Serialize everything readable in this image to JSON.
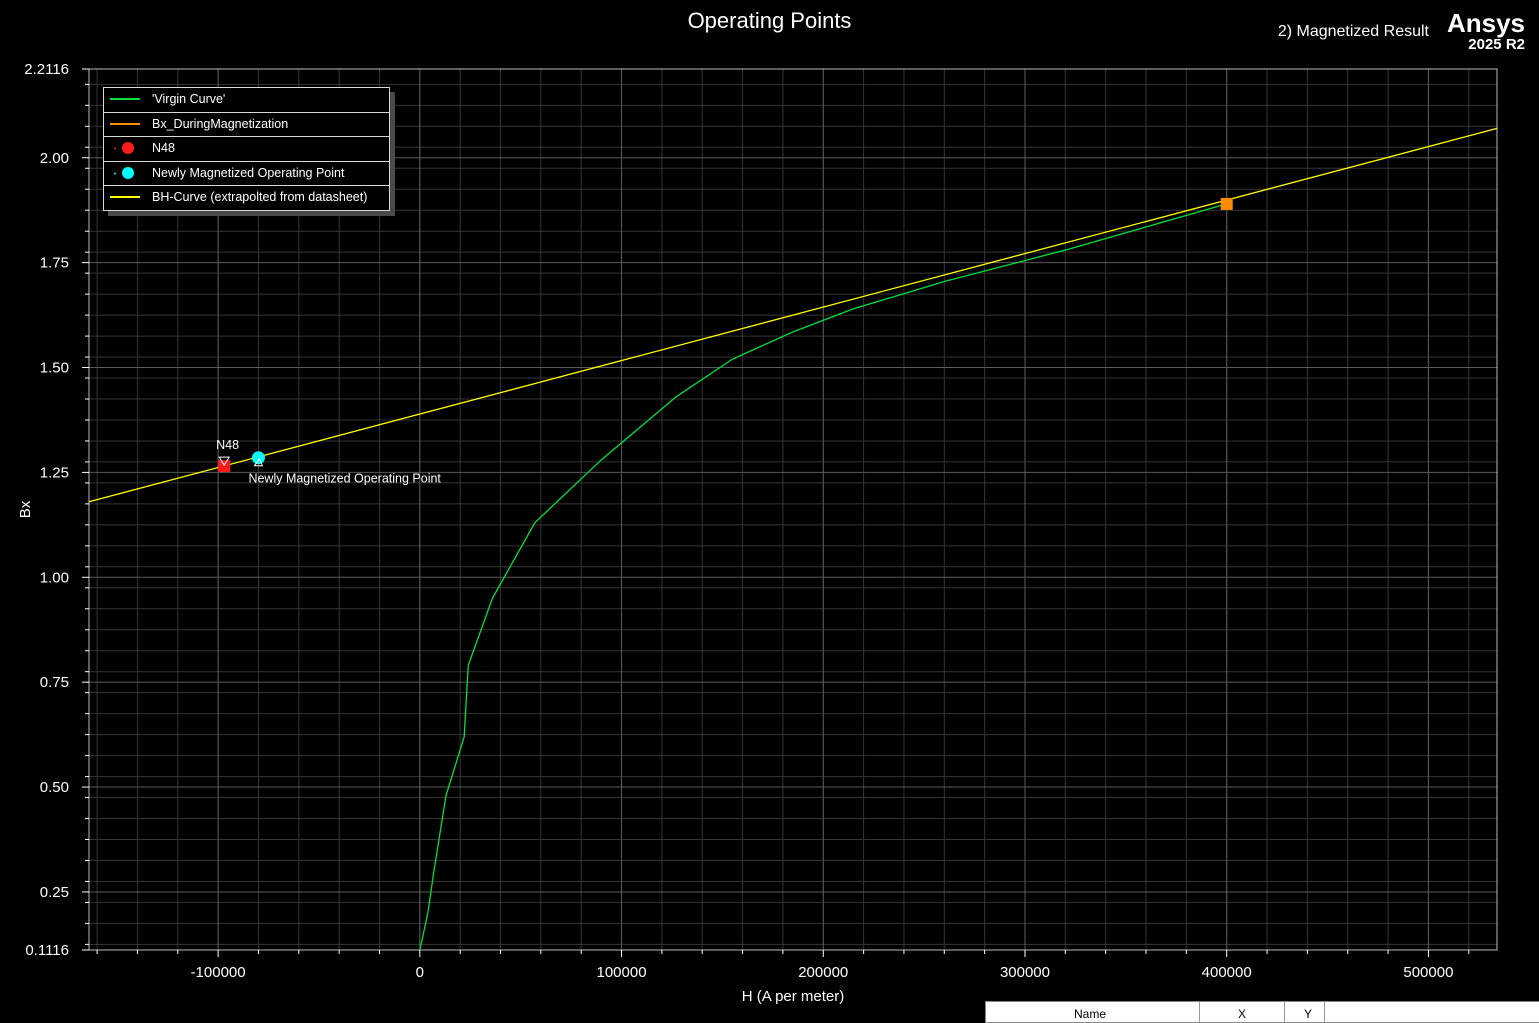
{
  "header": {
    "title": "Operating Points",
    "design_name": "2) Magnetized Result",
    "brand": "Ansys",
    "version": "2025 R2"
  },
  "colors": {
    "background": "#000000",
    "grid": "#5a5a5a",
    "axis_text": "#ffffff",
    "virgin": "#00e040",
    "during": "#ff8c00",
    "n48": "#ff1a1a",
    "newly": "#00ffff",
    "bh": "#ffff00"
  },
  "legend": [
    {
      "label": "'Virgin Curve'",
      "kind": "line",
      "color": "#00e040"
    },
    {
      "label": "Bx_DuringMagnetization",
      "kind": "line",
      "color": "#ff8c00"
    },
    {
      "label": "N48",
      "kind": "marker",
      "color": "#ff1a1a"
    },
    {
      "label": "Newly Magnetized Operating Point",
      "kind": "marker",
      "color": "#00ffff"
    },
    {
      "label": "BH-Curve (extrapolted from datasheet)",
      "kind": "line",
      "color": "#ffff00"
    }
  ],
  "chart_data": {
    "type": "line",
    "title": "Operating Points",
    "xlabel": "H (A  per  meter)",
    "ylabel": "Bx",
    "xlim": [
      -164000,
      534000
    ],
    "ylim": [
      0.1116,
      2.2116
    ],
    "x_ticks": [
      -100000,
      0,
      100000,
      200000,
      300000,
      400000,
      500000
    ],
    "x_tick_labels": [
      "-100000",
      "0",
      "100000",
      "200000",
      "300000",
      "400000",
      "500000"
    ],
    "x_minor_step": 20000,
    "y_ticks": [
      0.1116,
      0.25,
      0.5,
      0.75,
      1.0,
      1.25,
      1.5,
      1.75,
      2.0,
      2.2116
    ],
    "y_tick_labels": [
      "0.1116",
      "0.25",
      "0.50",
      "0.75",
      "1.00",
      "1.25",
      "1.50",
      "1.75",
      "2.00",
      "2.2116"
    ],
    "grid": true,
    "legend_position": "top-left",
    "series": [
      {
        "name": "'Virgin Curve'",
        "color": "#00e040",
        "points": [
          [
            0,
            0.1116
          ],
          [
            4000,
            0.2
          ],
          [
            7000,
            0.3
          ],
          [
            13000,
            0.48
          ],
          [
            22000,
            0.62
          ],
          [
            24000,
            0.79
          ],
          [
            36000,
            0.95
          ],
          [
            57000,
            1.13
          ],
          [
            90000,
            1.28
          ],
          [
            127000,
            1.43
          ],
          [
            155000,
            1.52
          ],
          [
            185000,
            1.585
          ],
          [
            215000,
            1.64
          ],
          [
            260000,
            1.705
          ],
          [
            320000,
            1.78
          ],
          [
            400000,
            1.89
          ]
        ]
      },
      {
        "name": "Bx_DuringMagnetization",
        "color": "#ff8c00",
        "points": [
          [
            400000,
            1.89
          ]
        ]
      },
      {
        "name": "N48",
        "color": "#ff1a1a",
        "points": [
          [
            -97000,
            1.265
          ]
        ]
      },
      {
        "name": "Newly Magnetized Operating Point",
        "color": "#00ffff",
        "points": [
          [
            -80000,
            1.285
          ]
        ]
      },
      {
        "name": "BH-Curve (extrapolted from datasheet)",
        "color": "#ffff00",
        "points": [
          [
            -164000,
            1.18
          ],
          [
            534000,
            2.07
          ]
        ]
      }
    ],
    "annotations": [
      {
        "text": "N48",
        "x": -97000,
        "y": 1.265
      },
      {
        "text": "Newly Magnetized Operating Point",
        "x": -80000,
        "y": 1.285
      }
    ]
  },
  "table": {
    "col_name": "Name",
    "col_x": "X",
    "col_y": "Y"
  }
}
